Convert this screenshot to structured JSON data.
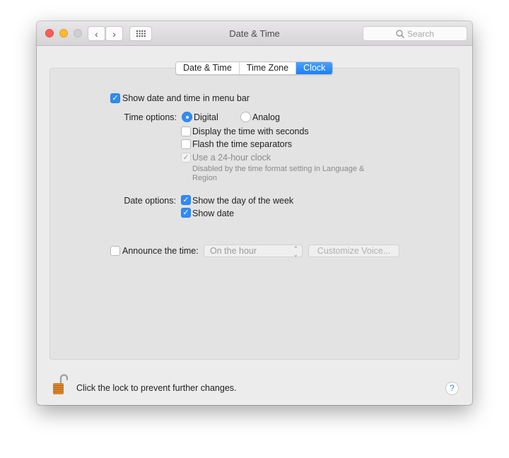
{
  "window": {
    "title": "Date & Time",
    "search_placeholder": "Search"
  },
  "tabs": [
    {
      "label": "Date & Time",
      "active": false
    },
    {
      "label": "Time Zone",
      "active": false
    },
    {
      "label": "Clock",
      "active": true
    }
  ],
  "clock": {
    "show_in_menu_bar": {
      "label": "Show date and time in menu bar",
      "checked": true
    },
    "time_options": {
      "label": "Time options:",
      "digital": {
        "label": "Digital",
        "selected": true
      },
      "analog": {
        "label": "Analog",
        "selected": false
      },
      "seconds": {
        "label": "Display the time with seconds",
        "checked": false
      },
      "flash": {
        "label": "Flash the time separators",
        "checked": false
      },
      "hour24": {
        "label": "Use a 24-hour clock",
        "checked": true,
        "disabled": true
      },
      "note_line1": "Disabled by the time format setting in Language &",
      "note_line2": "Region"
    },
    "date_options": {
      "label": "Date options:",
      "day_of_week": {
        "label": "Show the day of the week",
        "checked": true
      },
      "show_date": {
        "label": "Show date",
        "checked": true
      }
    },
    "announce": {
      "label": "Announce the time:",
      "checked": false,
      "interval": "On the hour",
      "customize": "Customize Voice..."
    }
  },
  "footer": {
    "lock_text": "Click the lock to prevent further changes.",
    "help": "?"
  },
  "colors": {
    "accent": "#2f8cf8",
    "close": "#fc5f57",
    "minimize": "#fdbc2e",
    "zoom": "#cfcfcf"
  }
}
